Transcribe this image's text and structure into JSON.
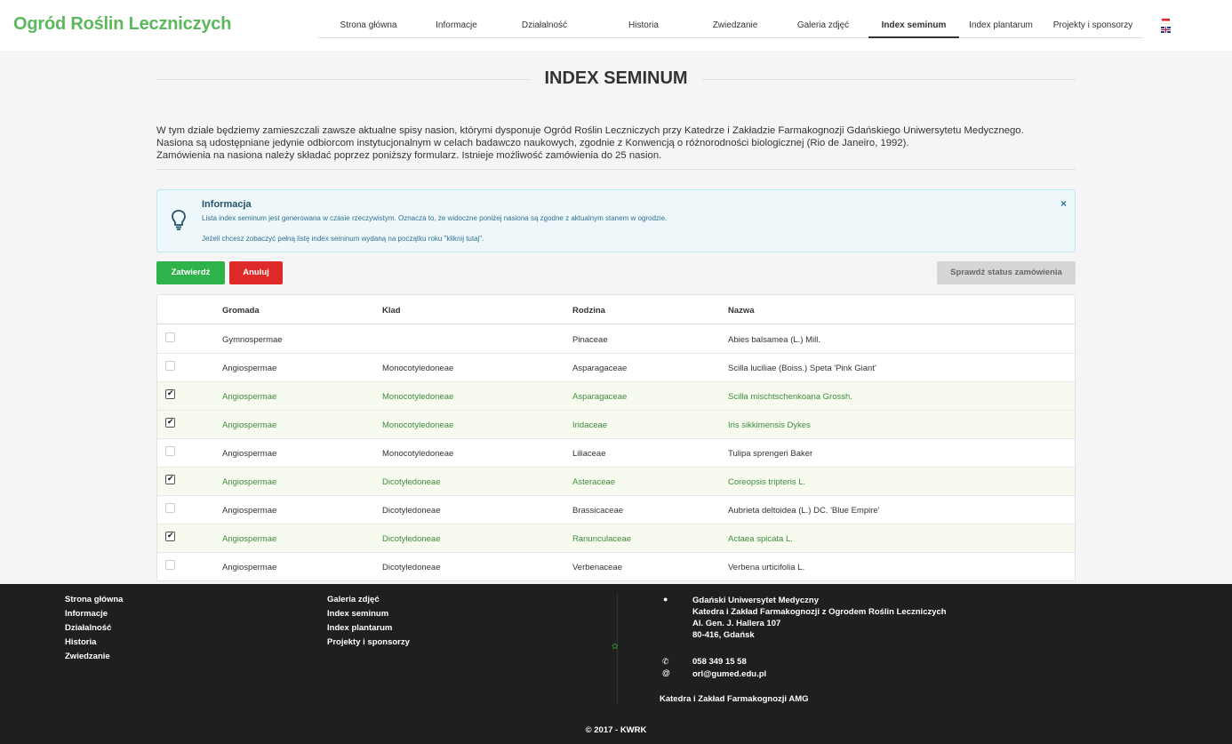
{
  "header": {
    "logo": "Ogród Roślin Leczniczych",
    "nav": [
      {
        "label": "Strona główna"
      },
      {
        "label": "Informacje"
      },
      {
        "label": "Działalność"
      },
      {
        "label": "Historia"
      },
      {
        "label": "Zwiedzanie"
      },
      {
        "label": "Galeria zdjęć"
      },
      {
        "label": "Index seminum",
        "active": true
      },
      {
        "label": "Index plantarum"
      },
      {
        "label": "Projekty i sponsorzy"
      }
    ],
    "flag_icons": [
      "polish-flag-icon",
      "english-flag-icon"
    ]
  },
  "main": {
    "title": "INDEX SEMINUM",
    "intro": [
      "W tym dziale będziemy zamieszczali zawsze aktualne spisy nasion, którymi dysponuje Ogród Roślin Leczniczych przy Katedrze i Zakładzie Farmakognozji Gdańskiego Uniwersytetu Medycznego.",
      "Nasiona są udostępniane jedynie odbiorcom instytucjonalnym w celach badawczo naukowych, zgodnie z Konwencją o różnorodności biologicznej (Rio de Janeiro, 1992).",
      "Zamówienia na nasiona należy składać poprzez poniższy formularz. Istnieje możliwość zamówienia do 25 nasion."
    ],
    "alert": {
      "icon": "lightbulb-icon",
      "title": "Informacja",
      "line1": "Lista index seminum jest generowana w czasie rzeczywistym. Oznacza to, że widoczne poniżej nasiona są zgodne z aktualnym stanem w ogrodzie.",
      "line2": "Jeżeli chcesz zobaczyć pełną listę index seminum wydaną na początku roku \"kliknij tutaj\".",
      "close": "×"
    },
    "buttons": {
      "confirm": "Zatwierdź",
      "cancel": "Anuluj",
      "status": "Sprawdź status zamówienia"
    },
    "table": {
      "columns": [
        "Gromada",
        "Klad",
        "Rodzina",
        "Nazwa"
      ],
      "rows": [
        {
          "checked": false,
          "gromada": "Gymnospermae",
          "klad": "",
          "rodzina": "Pinaceae",
          "nazwa": "Abies balsamea (L.) Mill."
        },
        {
          "checked": false,
          "gromada": "Angiospermae",
          "klad": "Monocotyledoneae",
          "rodzina": "Asparagaceae",
          "nazwa": "Scilla luciliae (Boiss.) Speta 'Pink Giant'"
        },
        {
          "checked": true,
          "gromada": "Angiospermae",
          "klad": "Monocotyledoneae",
          "rodzina": "Asparagaceae",
          "nazwa": "Scilla mischtschenkoana Grossh."
        },
        {
          "checked": true,
          "gromada": "Angiospermae",
          "klad": "Monocotyledoneae",
          "rodzina": "Iridaceae",
          "nazwa": "Iris sikkimensis Dykes"
        },
        {
          "checked": false,
          "gromada": "Angiospermae",
          "klad": "Monocotyledoneae",
          "rodzina": "Liliaceae",
          "nazwa": "Tulipa sprengeri Baker"
        },
        {
          "checked": true,
          "gromada": "Angiospermae",
          "klad": "Dicotyledoneae",
          "rodzina": "Asteraceae",
          "nazwa": "Coreopsis tripteris L."
        },
        {
          "checked": false,
          "gromada": "Angiospermae",
          "klad": "Dicotyledoneae",
          "rodzina": "Brassicaceae",
          "nazwa": "Aubrieta deltoidea (L.) DC. 'Blue Empire'"
        },
        {
          "checked": true,
          "gromada": "Angiospermae",
          "klad": "Dicotyledoneae",
          "rodzina": "Ranunculaceae",
          "nazwa": "Actaea spicata L."
        },
        {
          "checked": false,
          "gromada": "Angiospermae",
          "klad": "Dicotyledoneae",
          "rodzina": "Verbenaceae",
          "nazwa": "Verbena urticifolia L."
        }
      ]
    }
  },
  "footer": {
    "col1": [
      "Strona główna",
      "Informacje",
      "Działalność",
      "Historia",
      "Zwiedzanie"
    ],
    "col2": [
      "Galeria zdjęć",
      "Index seminum",
      "Index plantarum",
      "Projekty i sponsorzy"
    ],
    "address": [
      "Gdański Uniwersytet Medyczny",
      "Katedra i Zakład Farmakognozji z Ogrodem Roślin Leczniczych",
      "Al. Gen. J. Hallera 107",
      "80-416, Gdańsk"
    ],
    "address_icon": "map-marker-icon",
    "phone": "058 349 15 58",
    "phone_icon": "phone-icon",
    "email": "orl@gumed.edu.pl",
    "email_icon": "at-icon",
    "affiliation": "Katedra i Zakład Farmakognozji AMG",
    "copyright": "© 2017 - KWRK"
  }
}
